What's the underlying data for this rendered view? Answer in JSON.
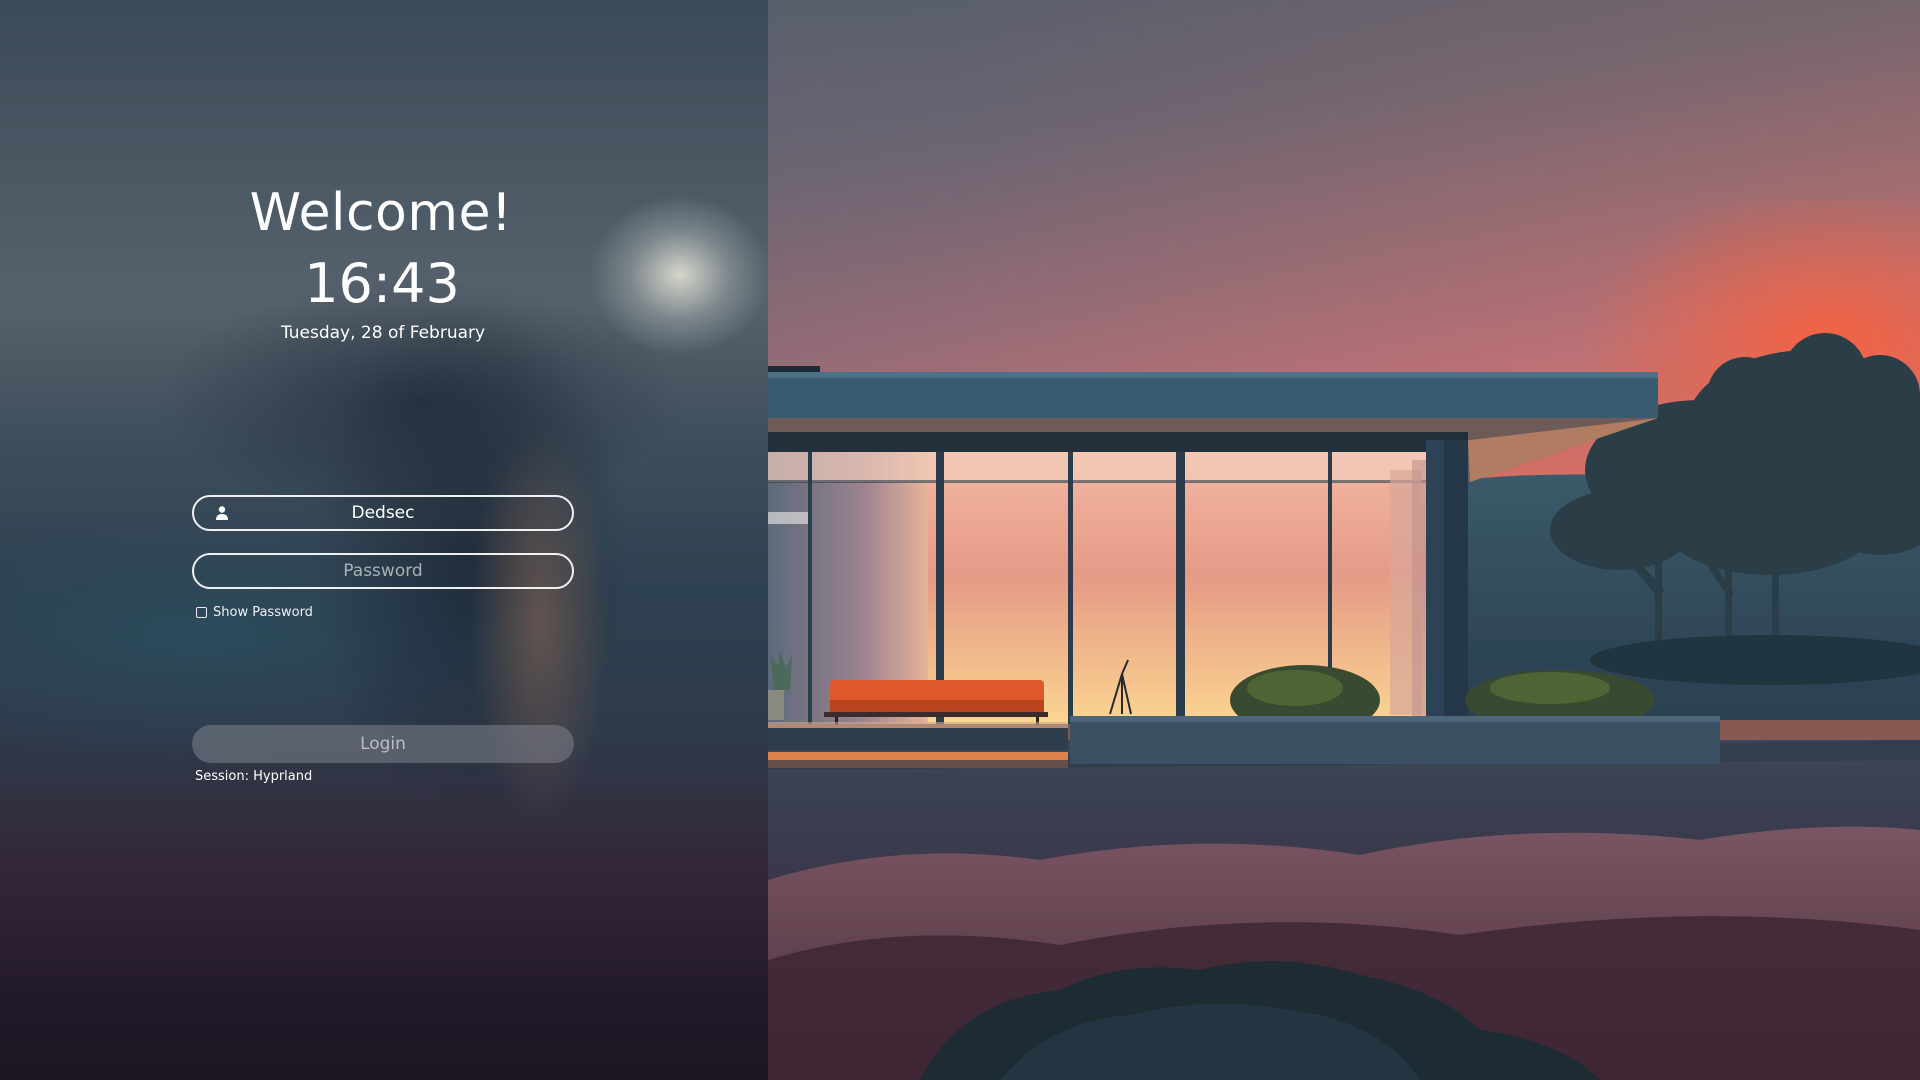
{
  "greeting": {
    "title": "Welcome!",
    "time": "16:43",
    "date": "Tuesday, 28 of February"
  },
  "login_form": {
    "username_value": "Dedsec",
    "password_placeholder": "Password",
    "show_password_label": "Show Password",
    "show_password_checked": false,
    "login_button_label": "Login",
    "session_label": "Session: Hyprland"
  },
  "icons": {
    "username": "user-icon",
    "show_password": "checkbox-icon"
  },
  "colors": {
    "text": "#ffffff",
    "field_border": "#ffffff",
    "login_button_bg": "#7d828c",
    "sky_top": "#4b5f6e",
    "sky_sunset": "#f06b4a",
    "window_glow": "#f6c58a",
    "couch": "#e0582a"
  }
}
